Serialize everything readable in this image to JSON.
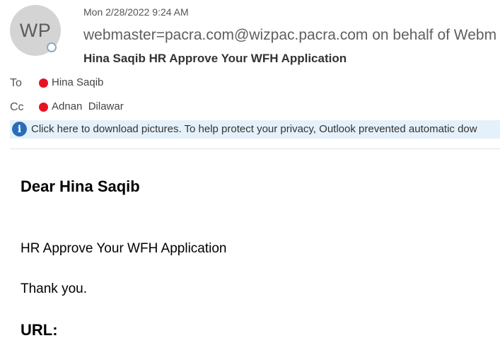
{
  "sender": {
    "initials": "WP",
    "display": "webmaster=pacra.com@wizpac.pacra.com on behalf of Webm"
  },
  "message": {
    "date": "Mon 2/28/2022 9:24 AM",
    "subject": "Hina Saqib HR Approve Your WFH Application"
  },
  "recipients": {
    "to_label": "To",
    "to_name": "Hina Saqib",
    "cc_label": "Cc",
    "cc_name": "Adnan  Dilawar"
  },
  "infobar": {
    "text": "Click here to download pictures. To help protect your privacy, Outlook prevented automatic dow"
  },
  "body": {
    "greeting": "Dear Hina Saqib",
    "line1": "HR Approve Your WFH Application",
    "line2": "Thank you.",
    "url_heading": "URL:"
  },
  "colors": {
    "presence_busy": "#e81123",
    "info_icon": "#2b6cb7",
    "infobar_bg": "#e5f1fa"
  }
}
